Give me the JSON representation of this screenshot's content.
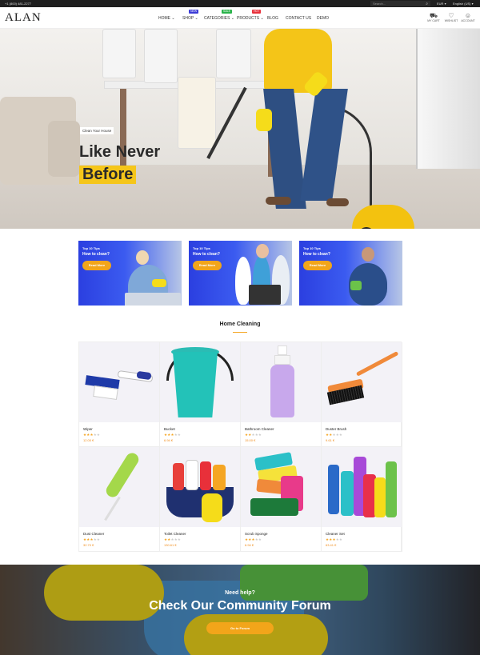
{
  "topbar": {
    "phone": "+1 (800) 481-2277",
    "search_placeholder": "Search...",
    "currency": "EUR",
    "language": "English (US)"
  },
  "header": {
    "logo": "ALAN",
    "nav": [
      {
        "label": "HOME",
        "caret": true
      },
      {
        "label": "SHOP",
        "caret": true,
        "badge": "NEW",
        "badge_color": "#3b3bd6"
      },
      {
        "label": "CATEGORIES",
        "caret": true,
        "badge": "SALE",
        "badge_color": "#2ab34a"
      },
      {
        "label": "PRODUCTS",
        "caret": true,
        "badge": "HOT",
        "badge_color": "#e8303a"
      },
      {
        "label": "BLOG",
        "caret": false
      },
      {
        "label": "CONTACT US",
        "caret": false
      },
      {
        "label": "DEMO",
        "caret": false
      }
    ],
    "icons": [
      {
        "name": "cart-icon",
        "label": "MY CART",
        "glyph": "🛒"
      },
      {
        "name": "heart-icon",
        "label": "WISHLIST",
        "glyph": "♡"
      },
      {
        "name": "user-icon",
        "label": "ACCOUNT",
        "glyph": "👤"
      }
    ]
  },
  "hero": {
    "tag": "Clean Your House",
    "line1": "Like Never",
    "line2": "Before"
  },
  "promos": [
    {
      "title": "Top 10 Tips",
      "subtitle": "How to clean?",
      "button": "Read More"
    },
    {
      "title": "Top 10 Tips",
      "subtitle": "How to clean?",
      "button": "Read More"
    },
    {
      "title": "Top 10 Tips",
      "subtitle": "How to clean?",
      "button": "Read More"
    }
  ],
  "section": {
    "title": "Home Cleaning"
  },
  "products": [
    {
      "name": "Wiper",
      "rating": 3,
      "price": "12.00 €",
      "icon": "wiper-icon"
    },
    {
      "name": "Bucket",
      "rating": 3,
      "price": "6.94 €",
      "icon": "bucket-icon"
    },
    {
      "name": "Bathroom Cleaner",
      "rating": 2,
      "price": "15.00 €",
      "icon": "bottle-icon"
    },
    {
      "name": "Duster Brush",
      "rating": 2,
      "price": "9.61 €",
      "icon": "brush-icon"
    },
    {
      "name": "Dust Cleaner",
      "rating": 3,
      "price": "32.70 €",
      "icon": "duster-icon"
    },
    {
      "name": "Toilet Cleaner",
      "rating": 2,
      "price": "130.61 €",
      "icon": "cleaning-kit-icon"
    },
    {
      "name": "Scrub Sponge",
      "rating": 3,
      "price": "6.94 €",
      "icon": "sponge-icon"
    },
    {
      "name": "Cleaner Set",
      "rating": 3,
      "price": "63.41 €",
      "icon": "bottles-icon"
    }
  ],
  "cta": {
    "need": "Need help?",
    "heading": "Check Our Community Forum",
    "button": "Go to Forum"
  },
  "colors": {
    "accent": "#f5a623",
    "yellow": "#f5c61a",
    "topbar": "#1f1f1f"
  }
}
